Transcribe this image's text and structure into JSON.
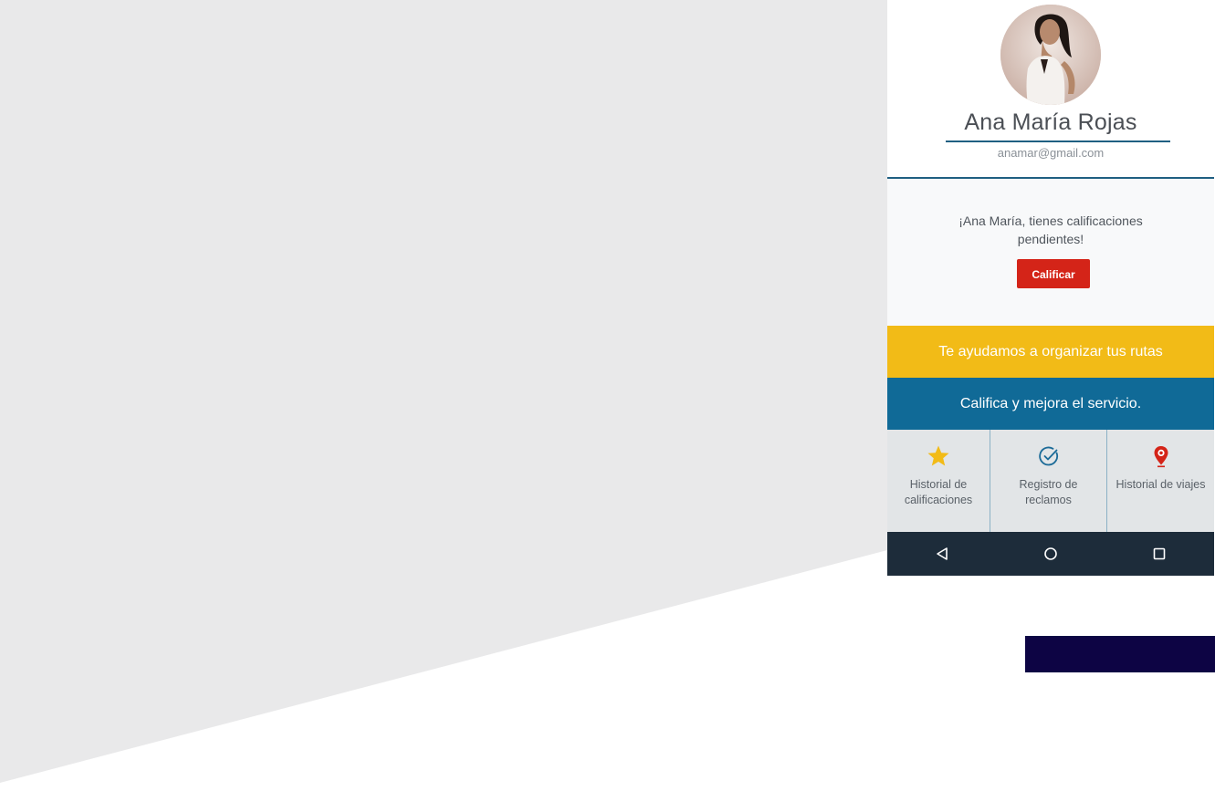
{
  "colors": {
    "accent_blue": "#106a97",
    "accent_yellow": "#f2bb17",
    "button_red": "#d42418",
    "navbar_dark": "#1d2c3a",
    "background_gray": "#e9e9ea",
    "corner_bar": "#0d0444"
  },
  "profile": {
    "name": "Ana María Rojas",
    "email": "anamar@gmail.com",
    "avatar_icon": "user-photo"
  },
  "pending": {
    "message": "¡Ana María, tienes calificaciones pendientes!",
    "button_label": "Calificar"
  },
  "banners": {
    "routes": "Te ayudamos  a organizar tus rutas",
    "service": "Califica y mejora el servicio."
  },
  "shortcuts": [
    {
      "label": "Historial de calificaciones",
      "icon": "star-icon"
    },
    {
      "label": "Registro de reclamos",
      "icon": "check-circle-icon"
    },
    {
      "label": "Historial de viajes",
      "icon": "map-pin-icon"
    }
  ],
  "navbar": {
    "back_icon": "back-triangle-icon",
    "home_icon": "home-circle-icon",
    "recents_icon": "recents-square-icon"
  }
}
